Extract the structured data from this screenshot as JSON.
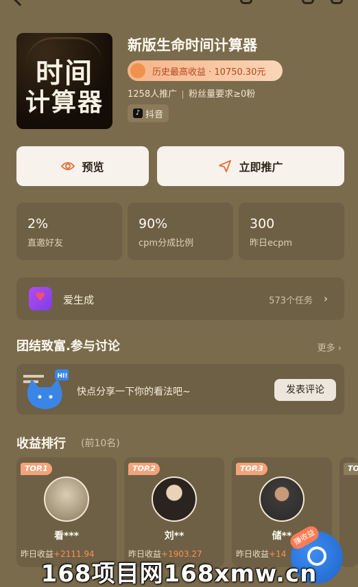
{
  "header": {
    "cover_title_line1": "时间",
    "cover_title_line2": "计算器",
    "title": "新版生命时间计算器",
    "badge": "历史最高收益 · 10750.30元",
    "promoters": "1258人推广",
    "fan_requirement": "粉丝量要求≥0粉",
    "platform": "抖音"
  },
  "actions": {
    "preview": "预览",
    "promote": "立即推广"
  },
  "stats": [
    {
      "value": "2%",
      "label": "直邀好友"
    },
    {
      "value": "90%",
      "label": "cpm分成比例"
    },
    {
      "value": "300",
      "label": "昨日ecpm"
    }
  ],
  "generator": {
    "name": "爱生成",
    "tasks": "573个任务"
  },
  "discussion": {
    "title": "团结致富.参与讨论",
    "more": "更多 ›",
    "hi": "HI!",
    "prompt": "快点分享一下你的看法吧~",
    "comment_button": "发表评论"
  },
  "ranking": {
    "title": "收益排行",
    "subtitle": "(前10名)",
    "items": [
      {
        "tag": "TOP.1",
        "name": "看***",
        "earn_label": "昨日收益",
        "amount": "+2111.94"
      },
      {
        "tag": "TOP.2",
        "name": "刘**",
        "earn_label": "昨日收益",
        "amount": "+1903.27"
      },
      {
        "tag": "TOP.3",
        "name": "储**",
        "earn_label": "昨日收益",
        "amount": "+14"
      }
    ],
    "fourth_tag": "TO"
  },
  "float_button": {
    "label": "赚收益"
  },
  "watermark": "168项目网168xmw.cn",
  "colors": {
    "background": "#7a6b4c",
    "card": "#6e6044",
    "accent": "#f0924d",
    "earn": "#ff8d5c"
  }
}
